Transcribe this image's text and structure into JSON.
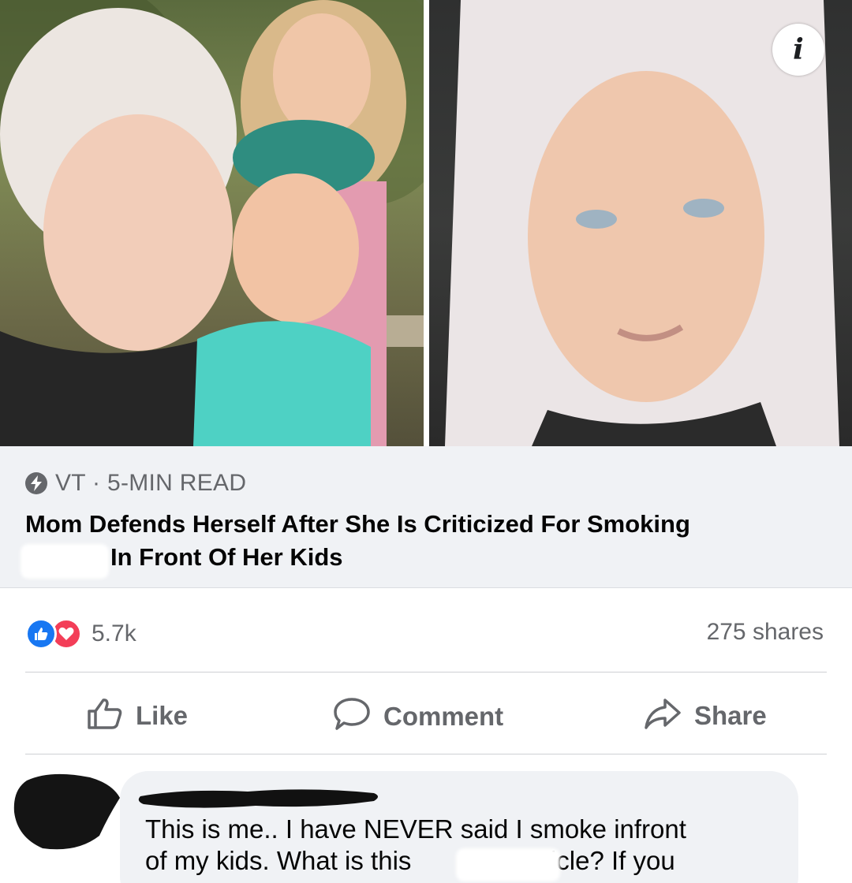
{
  "post": {
    "link_preview": {
      "source": "VT · 5-MIN READ",
      "headline_line1": "Mom Defends Herself After She Is Criticized For Smoking",
      "headline_line2": "In Front Of Her Kids"
    },
    "reactions_count": "5.7k",
    "shares": "275 shares",
    "actions": {
      "like": "Like",
      "comment": "Comment",
      "share": "Share"
    },
    "info_icon_glyph": "i"
  },
  "comment": {
    "line1": "This is me.. I have NEVER said I smoke infront",
    "line2a": "of my kids. What is this",
    "line2b": "article? If you"
  },
  "colors": {
    "like_blue": "#1877f2",
    "love_red": "#f33e58",
    "secondary_text": "#65676b",
    "preview_bg": "#f0f2f5"
  },
  "icons": [
    "bolt-icon",
    "info-icon",
    "like-reaction-icon",
    "love-reaction-icon",
    "thumbs-up-icon",
    "comment-bubble-icon",
    "share-arrow-icon"
  ]
}
